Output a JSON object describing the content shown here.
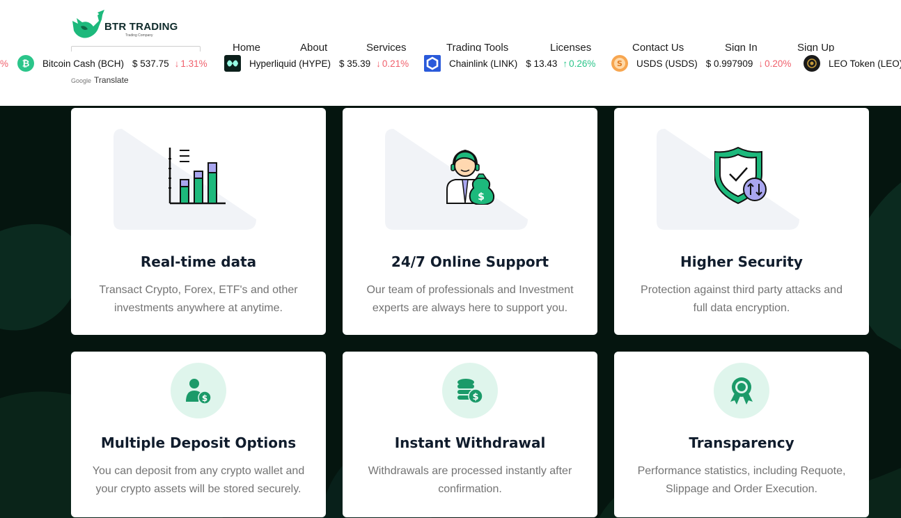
{
  "brand": {
    "name": "BTR TRADING",
    "tagline": "Trading Company",
    "color": "#0e2a2a",
    "accent": "#1db97c"
  },
  "translate": {
    "google": "Google",
    "label": "Translate"
  },
  "nav": [
    "Home",
    "About",
    "Services",
    "Trading Tools",
    "Licenses",
    "Contact Us",
    "Sign In",
    "Sign Up"
  ],
  "ticker": {
    "lead_fragment": "%",
    "items": [
      {
        "name": "Bitcoin Cash (BCH)",
        "price": "$ 537.75",
        "change": "1.31%",
        "direction": "down",
        "arrow": "↓",
        "icon": "bitcoin-cash-icon"
      },
      {
        "name": "Hyperliquid (HYPE)",
        "price": "$ 35.39",
        "change": "0.21%",
        "direction": "down",
        "arrow": "↓",
        "icon": "hyperliquid-icon"
      },
      {
        "name": "Chainlink (LINK)",
        "price": "$ 13.43",
        "change": "0.26%",
        "direction": "up",
        "arrow": "↑",
        "icon": "chainlink-icon"
      },
      {
        "name": "USDS (USDS)",
        "price": "$ 0.997909",
        "change": "0.20%",
        "direction": "down",
        "arrow": "↓",
        "icon": "usds-icon"
      },
      {
        "name": "LEO Token (LEO)",
        "price": "",
        "change": "",
        "direction": "",
        "arrow": "",
        "icon": "leo-token-icon"
      }
    ],
    "colors": {
      "down": "#f0616d",
      "up": "#2bc58a"
    }
  },
  "features": [
    {
      "title": "Real-time data",
      "desc": "Transact Crypto, Forex, ETF's and other investments anywhere at anytime.",
      "icon": "bar-chart-icon"
    },
    {
      "title": "24/7 Online Support",
      "desc": "Our team of professionals and Investment experts are always here to support you.",
      "icon": "support-agent-icon"
    },
    {
      "title": "Higher Security",
      "desc": "Protection against third party attacks and full data encryption.",
      "icon": "shield-check-icon"
    },
    {
      "title": "Multiple Deposit Options",
      "desc": "You can deposit from any crypto wallet and your crypto assets will be stored securely.",
      "icon": "user-dollar-icon"
    },
    {
      "title": "Instant Withdrawal",
      "desc": "Withdrawals are processed instantly after confirmation.",
      "icon": "coins-dollar-icon"
    },
    {
      "title": "Transparency",
      "desc": "Performance statistics, including Requote, Slippage and Order Execution.",
      "icon": "award-badge-icon"
    }
  ],
  "colors": {
    "section_bg": "#05150f",
    "icon_green": "#1db97c",
    "icon_purple": "#a9a6ef",
    "circle_bg": "#dff5ec",
    "title_text": "#101c2c",
    "body_text": "#737373"
  }
}
